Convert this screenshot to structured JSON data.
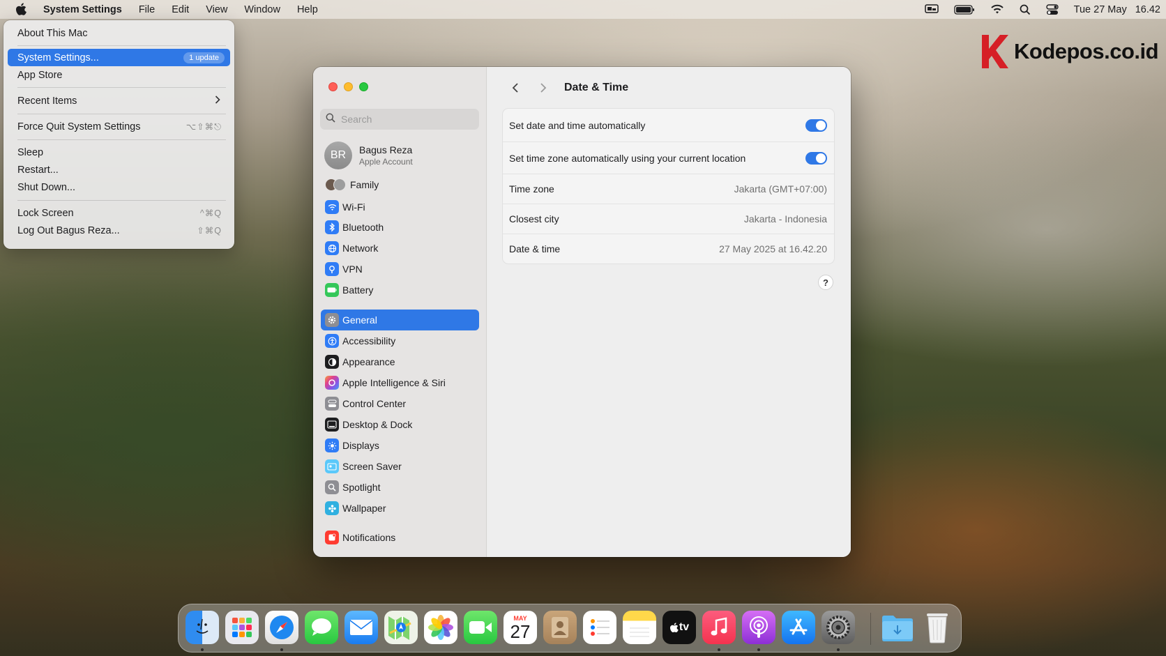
{
  "menubar": {
    "app_name": "System Settings",
    "items": [
      "File",
      "Edit",
      "View",
      "Window",
      "Help"
    ],
    "clock_date": "Tue 27 May",
    "clock_time": "16.42"
  },
  "apple_menu": {
    "about": "About This Mac",
    "system_settings": "System Settings...",
    "update_badge": "1 update",
    "app_store": "App Store",
    "recent_items": "Recent Items",
    "force_quit": "Force Quit System Settings",
    "force_quit_shortcut": "⌥⇧⌘⎋",
    "sleep": "Sleep",
    "restart": "Restart...",
    "shut_down": "Shut Down...",
    "lock_screen": "Lock Screen",
    "lock_shortcut": "^⌘Q",
    "log_out": "Log Out Bagus Reza...",
    "log_out_shortcut": "⇧⌘Q"
  },
  "watermark": {
    "text": "Kodepos.co.id",
    "brand_color": "#d61f26"
  },
  "sidebar": {
    "search_placeholder": "Search",
    "account": {
      "initials": "BR",
      "name": "Bagus Reza",
      "subtitle": "Apple Account"
    },
    "family": "Family",
    "items": [
      {
        "label": "Wi-Fi",
        "icon": "wifi-icon",
        "color": "#2f7cf6"
      },
      {
        "label": "Bluetooth",
        "icon": "bluetooth-icon",
        "color": "#2f7cf6"
      },
      {
        "label": "Network",
        "icon": "globe-icon",
        "color": "#2f7cf6"
      },
      {
        "label": "VPN",
        "icon": "vpn-icon",
        "color": "#2f7cf6"
      },
      {
        "label": "Battery",
        "icon": "battery-icon",
        "color": "#34c759"
      },
      {
        "label": "General",
        "icon": "gear-icon",
        "color": "#8e8e93"
      },
      {
        "label": "Accessibility",
        "icon": "accessibility-icon",
        "color": "#2f7cf6"
      },
      {
        "label": "Appearance",
        "icon": "appearance-icon",
        "color": "#1d1d1f"
      },
      {
        "label": "Apple Intelligence & Siri",
        "icon": "siri-icon",
        "color": "#c864e6"
      },
      {
        "label": "Control Center",
        "icon": "control-center-icon",
        "color": "#8e8e93"
      },
      {
        "label": "Desktop & Dock",
        "icon": "desktop-dock-icon",
        "color": "#1d1d1f"
      },
      {
        "label": "Displays",
        "icon": "displays-icon",
        "color": "#2f7cf6"
      },
      {
        "label": "Screen Saver",
        "icon": "screen-saver-icon",
        "color": "#5ac8fa"
      },
      {
        "label": "Spotlight",
        "icon": "spotlight-icon",
        "color": "#8e8e93"
      },
      {
        "label": "Wallpaper",
        "icon": "wallpaper-icon",
        "color": "#30b0e0"
      },
      {
        "label": "Notifications",
        "icon": "notifications-icon",
        "color": "#ff3b30"
      }
    ],
    "active": "General"
  },
  "content": {
    "title": "Date & Time",
    "rows": [
      {
        "label": "Set date and time automatically",
        "toggle": true
      },
      {
        "label": "Set time zone automatically using your current location",
        "toggle": true
      },
      {
        "label": "Time zone",
        "value": "Jakarta (GMT+07:00)"
      },
      {
        "label": "Closest city",
        "value": "Jakarta - Indonesia"
      },
      {
        "label": "Date & time",
        "value": "27 May 2025 at 16.42.20"
      }
    ],
    "help": "?"
  },
  "dock": {
    "calendar_month": "MAY",
    "calendar_day": "27",
    "tv_label": "tv",
    "apps": [
      "finder",
      "launchpad",
      "safari",
      "messages",
      "mail",
      "maps",
      "photos",
      "facetime",
      "calendar",
      "contacts",
      "reminders",
      "notes",
      "apple-tv",
      "music",
      "podcasts",
      "app-store",
      "system-settings",
      "downloads",
      "trash"
    ]
  }
}
